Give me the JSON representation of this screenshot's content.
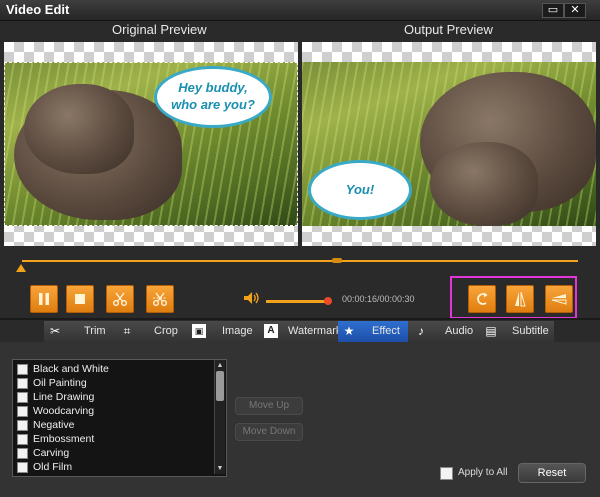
{
  "window": {
    "title": "Video Edit",
    "maximize_glyph": "▭",
    "close_glyph": "✕"
  },
  "preview": {
    "original_label": "Original Preview",
    "output_label": "Output Preview",
    "original_bubble": "Hey buddy,\nwho are you?",
    "output_bubble": "You!"
  },
  "controls": {
    "buttons": [
      "pause-icon",
      "stop-icon",
      "scissors-icon",
      "split-scissors-icon"
    ],
    "time": "00:00:16/00:00:30",
    "volume_level": 0.95,
    "transform_buttons": [
      "rotate-icon",
      "flip-vertical-icon",
      "flip-horizontal-icon"
    ],
    "accent": "#f3a31b",
    "highlight_color": "#e236d8"
  },
  "tabs": [
    {
      "label": "Trim",
      "icon": "scissors-icon"
    },
    {
      "label": "Crop",
      "icon": "crop-icon"
    },
    {
      "label": "Image",
      "icon": "image-icon"
    },
    {
      "label": "Watermark",
      "icon": "watermark-icon"
    },
    {
      "label": "Effect",
      "icon": "star-icon",
      "active": true
    },
    {
      "label": "Audio",
      "icon": "music-note-icon"
    },
    {
      "label": "Subtitle",
      "icon": "subtitle-icon"
    }
  ],
  "effects": [
    "Black and White",
    "Oil Painting",
    "Line Drawing",
    "Woodcarving",
    "Negative",
    "Embossment",
    "Carving",
    "Old Film"
  ],
  "buttons": {
    "move_up": "Move Up",
    "move_down": "Move Down",
    "apply_to_all": "Apply to All",
    "reset": "Reset"
  }
}
